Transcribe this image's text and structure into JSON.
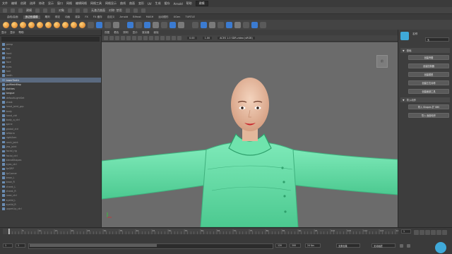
{
  "menubar": {
    "items": [
      "文件",
      "编辑",
      "创建",
      "选择",
      "修改",
      "显示",
      "窗口",
      "网格",
      "编辑网格",
      "网格工具",
      "网格显示",
      "曲线",
      "曲面",
      "变形",
      "UV",
      "生成",
      "缓存",
      "Arnold",
      "帮助"
    ],
    "workspace_label": "建模"
  },
  "statusline": {
    "mode_label": "建模",
    "object_label": "对象",
    "live_label": "无激活曲面",
    "symmetry_label": "对称: 禁用",
    "right_icon": "pin-icon"
  },
  "shelf": {
    "tabs": [
      "曲线/曲面",
      "多边形建模",
      "雕刻",
      "绑定",
      "动画",
      "渲染",
      "FX",
      "FX 缓存",
      "自定义",
      "Arnold",
      "Bifrost",
      "MASH",
      "运动图形",
      "XGen",
      "TURTLE"
    ],
    "active_tab": "多边形建模",
    "orb_count": 10
  },
  "outliner": {
    "menu": [
      "显示",
      "显示",
      "帮助"
    ],
    "items": [
      "persp",
      "top",
      "front",
      "side",
      "face",
      "eyes",
      "hair",
      "teeth",
      "lowerTeeth",
      "guiMeshMap",
      "clothes",
      "tongue",
      "defaultLightSet",
      "chest",
      "head_joint_grp",
      "body",
      "hand_ctrl",
      "body_a_ctrl",
      "spine",
      "global_ctrl",
      "leftArm",
      "rightArm",
      "neck_joint",
      "jaw_joint",
      "facial_rig",
      "facial_ctrl",
      "blendShapes",
      "eyes_ctrl",
      "lipGRP",
      "lipCorner",
      "brow_L",
      "brow_R",
      "cheek_L",
      "cheek_R",
      "nose_ctrl",
      "eyelid_L",
      "eyelid_R",
      "upperLip_ctrl"
    ],
    "selected_index": 8,
    "highlighted_indices": [
      9,
      10,
      11
    ]
  },
  "viewport": {
    "menu": [
      "视图",
      "着色",
      "照明",
      "显示",
      "渲染器",
      "面板"
    ],
    "gamma_label": "ACES 1.0 SDR-video (sRGB)",
    "exposure_value": "0.00",
    "gamma_value": "1.00",
    "viewcube_label": "前",
    "character": {
      "skin_color": "#e9c0a4",
      "outfit_color": "#5ce0a0",
      "lip_color": "#c9252b"
    }
  },
  "right_panel": {
    "header_label": "名称",
    "field_value": "头",
    "section_main": "基础",
    "buttons_main": [
      "创建骨骼",
      "创建控制器",
      "创建模型",
      "创建左右对称",
      "创建面部工具"
    ],
    "section_second": "导入动作",
    "buttons_second": [
      "导入 Shapes 扩 SBS",
      "导入 面部动作"
    ]
  },
  "timeline": {
    "ticks": [
      "5",
      "10",
      "15",
      "20",
      "25",
      "30",
      "35",
      "40",
      "45",
      "50",
      "55",
      "60",
      "65",
      "70",
      "75",
      "80",
      "85",
      "90",
      "95",
      "100",
      "105",
      "110",
      "115",
      "120"
    ],
    "current_frame": "1"
  },
  "range": {
    "start": "1",
    "end": "120",
    "anim_start": "1",
    "anim_end": "120",
    "end_field_right": "200",
    "fps_label": "24 fps",
    "no_char_label": "无角色集",
    "no_anim_label": "无动画层"
  },
  "colors": {
    "accent_cyan": "#3fa9d9",
    "outfit_green": "#5ce0a0"
  }
}
